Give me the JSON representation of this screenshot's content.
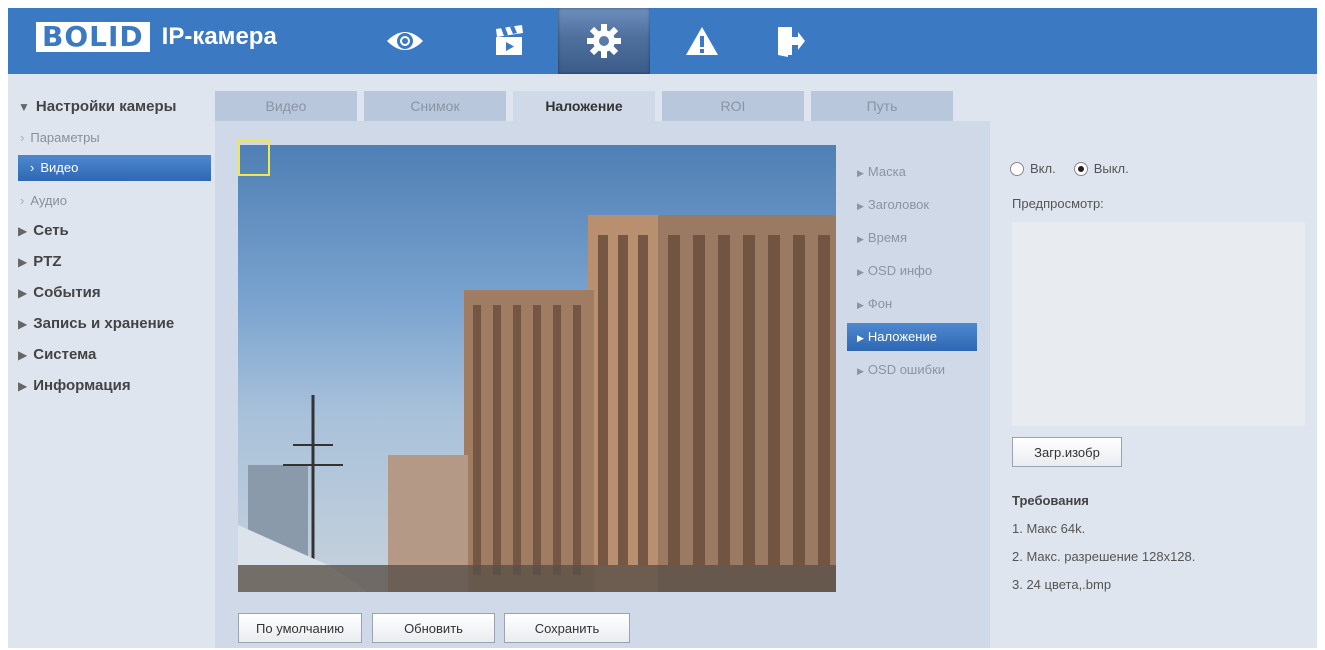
{
  "header": {
    "logo": "BOLID",
    "title": "IP-камера",
    "nav": [
      {
        "name": "live-view",
        "icon": "eye-icon"
      },
      {
        "name": "playback",
        "icon": "clapperboard-icon"
      },
      {
        "name": "setup",
        "icon": "gear-icon"
      },
      {
        "name": "alarm",
        "icon": "warning-icon"
      },
      {
        "name": "logout",
        "icon": "exit-icon"
      }
    ],
    "active_nav": "setup"
  },
  "sidebar": {
    "camera_settings": "Настройки камеры",
    "sub_params": "Параметры",
    "sub_video": "Видео",
    "sub_audio": "Аудио",
    "network": "Сеть",
    "ptz": "PTZ",
    "events": "События",
    "storage": "Запись и хранение",
    "system": "Система",
    "info": "Информация"
  },
  "tabs": {
    "video": "Видео",
    "snapshot": "Снимок",
    "overlay": "Наложение",
    "roi": "ROI",
    "path": "Путь",
    "active": "Наложение"
  },
  "submenu": {
    "mask": "Маска",
    "title": "Заголовок",
    "time": "Время",
    "osd_info": "OSD инфо",
    "background": "Фон",
    "overlay": "Наложение",
    "osd_errors": "OSD ошибки"
  },
  "overlay_panel": {
    "on_label": "Вкл.",
    "off_label": "Выкл.",
    "selected": "Выкл.",
    "preview_label": "Предпросмотр:",
    "upload_button": "Загр.изобр",
    "requirements_title": "Требования",
    "req_1": "1. Макс 64k.",
    "req_2": "2. Макс. разрешение 128x128.",
    "req_3": "3. 24 цвета,.bmp"
  },
  "buttons": {
    "default": "По умолчанию",
    "refresh": "Обновить",
    "save": "Сохранить"
  },
  "colors": {
    "header_blue": "#3b79c3",
    "active_blue": "#2f68b2",
    "panel_bg": "#dfe5ef",
    "content_bg": "#cfd9e8"
  }
}
